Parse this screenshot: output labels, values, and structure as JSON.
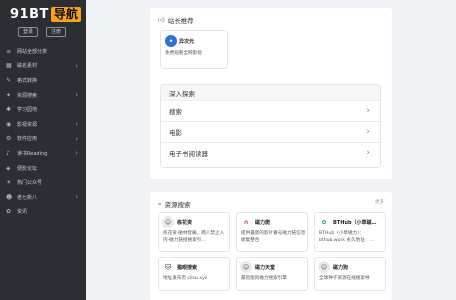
{
  "logo": {
    "text": "91BT",
    "badge": "导航"
  },
  "login": {
    "login_label": "登录",
    "register_label": "注册"
  },
  "sidebar": {
    "items": [
      {
        "icon": "≡",
        "label": "网站全部分类",
        "arrow": ""
      },
      {
        "icon": "▦",
        "label": "磁名素材",
        "arrow": "›"
      },
      {
        "icon": "✎",
        "label": "格式转换",
        "arrow": ""
      },
      {
        "icon": "✦",
        "label": "资源搜索",
        "arrow": "›"
      },
      {
        "icon": "✱",
        "label": "学习园地",
        "arrow": ""
      },
      {
        "icon": "◉",
        "label": "影视资源",
        "arrow": "›"
      },
      {
        "icon": "⚙",
        "label": "软件应用",
        "arrow": "›"
      },
      {
        "icon": "♪",
        "label": "读书Reading",
        "arrow": "›"
      },
      {
        "icon": "◈",
        "label": "便影论坛",
        "arrow": ""
      },
      {
        "icon": "☀",
        "label": "热门公众号",
        "arrow": ""
      },
      {
        "icon": "☻",
        "label": "老七新八",
        "arrow": "›"
      },
      {
        "icon": "✿",
        "label": "资讯",
        "arrow": ""
      }
    ]
  },
  "recommend": {
    "title": "站长推荐",
    "site": {
      "name": "异次元",
      "desc": "免费观看全网影视"
    }
  },
  "explore": {
    "title": "深入探索",
    "rows": [
      {
        "label": "搜索"
      },
      {
        "label": "电影"
      },
      {
        "label": "电子书阅读器"
      }
    ]
  },
  "resource": {
    "title": "资源搜索",
    "more": "更多",
    "sites": [
      {
        "name": "栋花资",
        "desc": "栋花资·磁林登痛，两人禁止入内-磁力链接搜索引…"
      },
      {
        "name": "磁力爬",
        "desc": "提供最新的影片番号磁力链信息收集整合"
      },
      {
        "name": "BTHub（小草磁…",
        "desc": "BTHub（小草磁力）：bthub.work 永久地址：…"
      },
      {
        "name": "猫眼搜索",
        "desc": "地址发布页 cilsu.xyz"
      },
      {
        "name": "磁力天堂",
        "desc": "最智能的磁力搜索引擎"
      },
      {
        "name": "磁力狗",
        "desc": "全球种子资源在线搜索导"
      }
    ]
  },
  "colors": {
    "sidebar_bg": "#2b2f33",
    "accent": "#f7a31b",
    "page_bg": "#f0f2f5"
  }
}
